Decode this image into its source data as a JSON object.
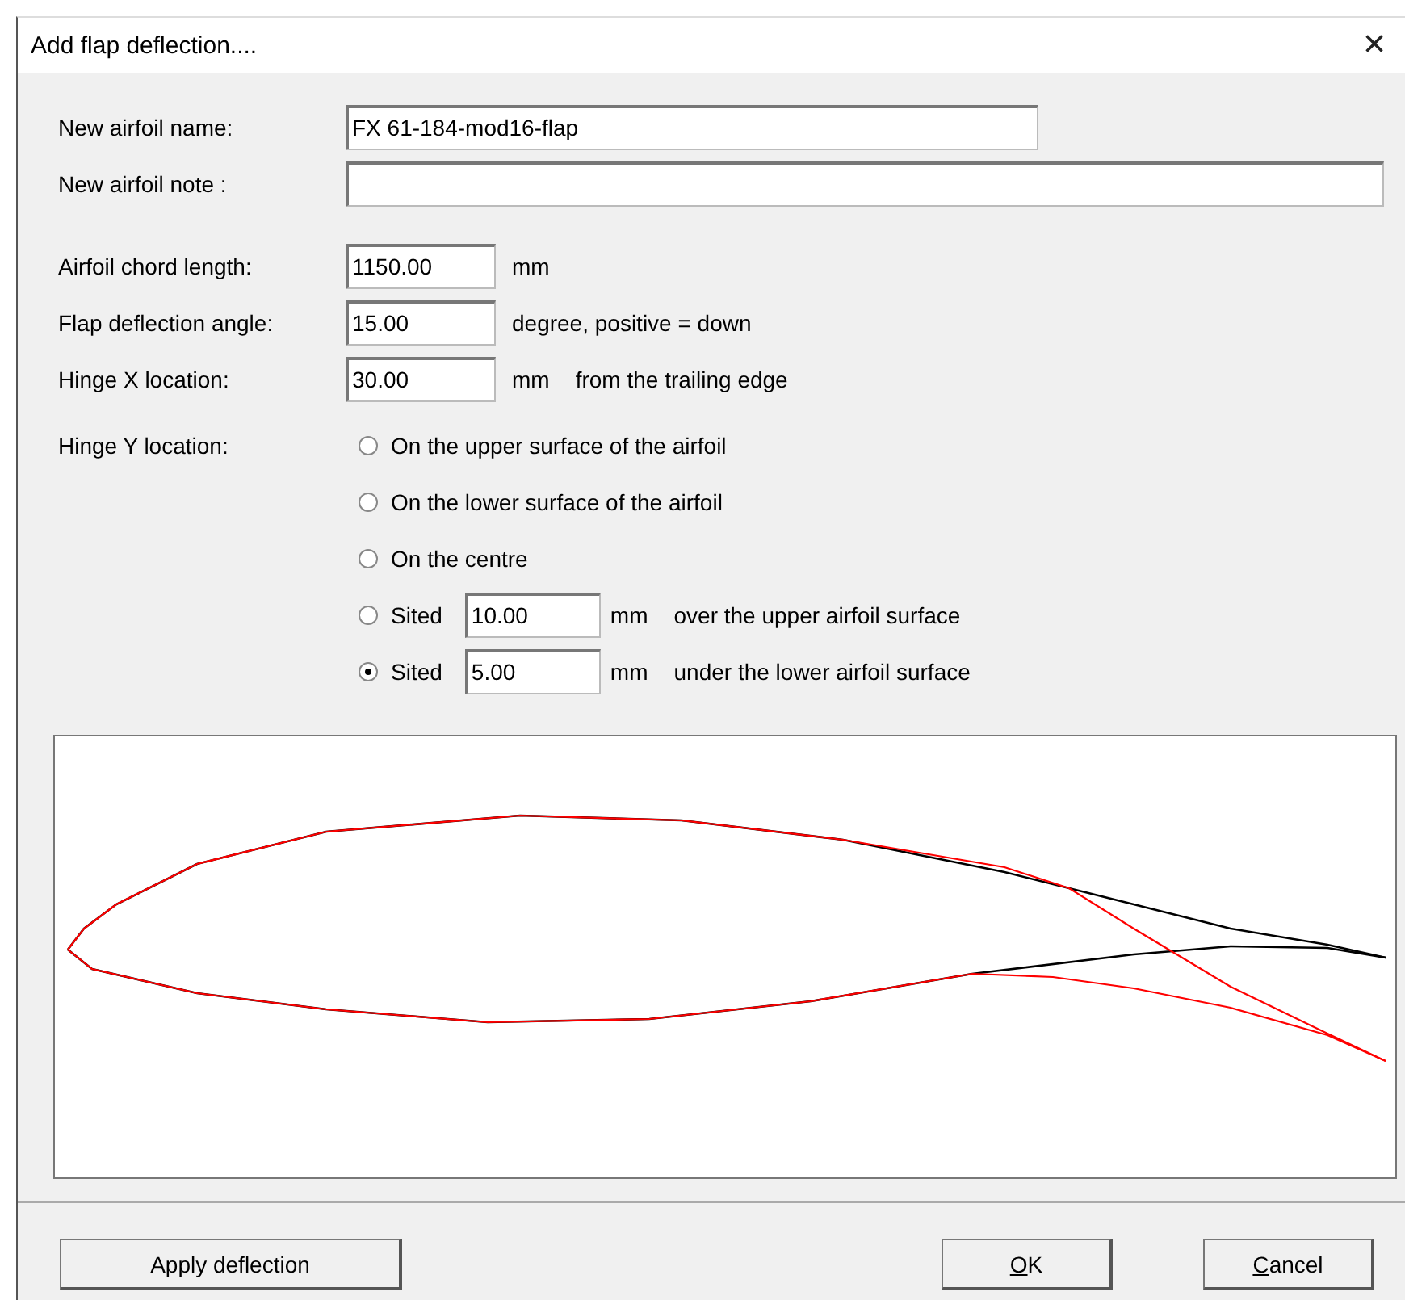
{
  "window": {
    "title": "Add flap deflection....",
    "close": "×"
  },
  "name_fields": [
    {
      "label": "New airfoil name:",
      "value": "FX 61-184-mod16-flap",
      "kind": "medium"
    },
    {
      "label": "New airfoil note :",
      "kind": "wide"
    }
  ],
  "params": [
    {
      "label": "Airfoil chord length:",
      "value": "1150.00",
      "unit": "mm"
    },
    {
      "label": "Flap deflection angle:",
      "value": "15.00",
      "unit": "degree, positive = down"
    },
    {
      "label": "Hinge X location:",
      "value": "30.00",
      "unit": "mm",
      "note": "from the trailing edge"
    }
  ],
  "hinge_y": {
    "label": "Hinge Y location:",
    "options": [
      {
        "kind": "plain",
        "label": "On the upper surface of the airfoil",
        "selected": false
      },
      {
        "kind": "plain",
        "label": "On the lower surface of the airfoil",
        "selected": false
      },
      {
        "kind": "plain",
        "label": "On the centre",
        "selected": false
      },
      {
        "kind": "sited",
        "label": "Sited",
        "value": "10.00",
        "unit": "mm",
        "note": "over the upper airfoil surface",
        "selected": false
      },
      {
        "kind": "sited",
        "label": "Sited",
        "value": "5.00",
        "unit": "mm",
        "note": "under the lower airfoil surface",
        "selected": true
      }
    ]
  },
  "buttons": [
    {
      "label": "Apply deflection",
      "kind": "left"
    },
    {
      "label": "OK",
      "kind": "right",
      "underline_first": true
    },
    {
      "label": "Cancel",
      "kind": "right",
      "underline_first": true
    }
  ]
}
